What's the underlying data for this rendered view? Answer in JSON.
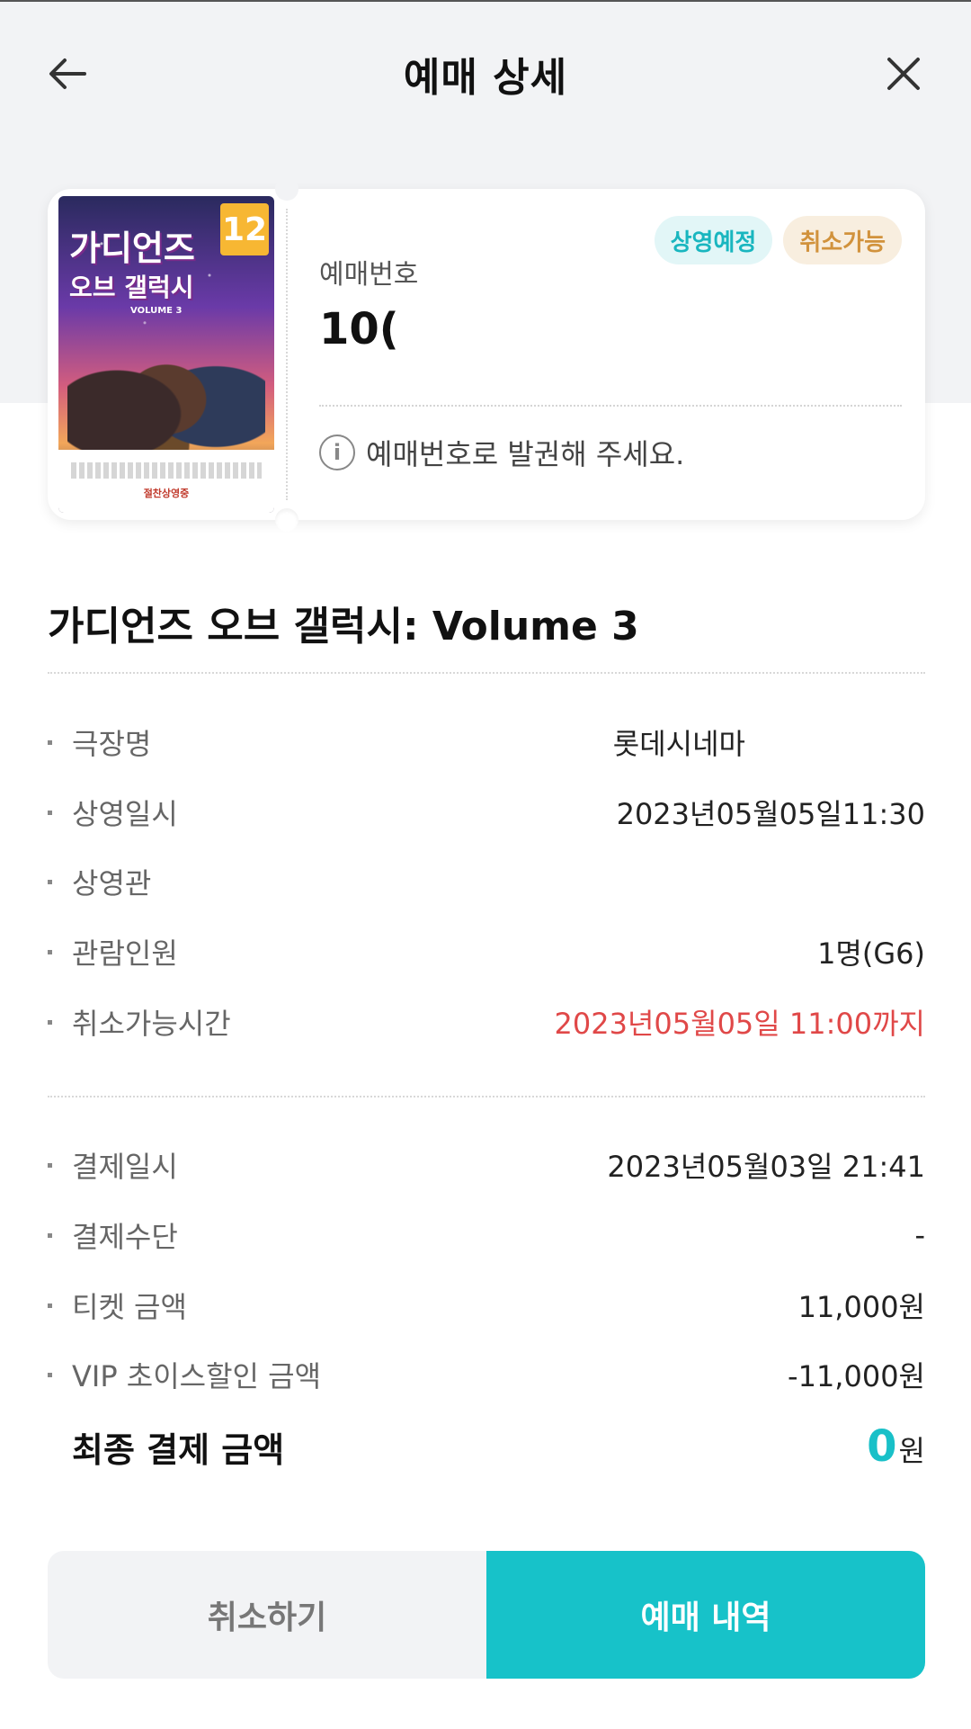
{
  "header": {
    "title": "예매 상세",
    "back_icon": "arrow-left-icon",
    "close_icon": "close-icon"
  },
  "ticket": {
    "poster": {
      "title_line1": "가디언즈",
      "title_line2": "오브 갤럭시",
      "rating": "12",
      "subtitle": "VOLUME 3",
      "release_text": "절찬상영중"
    },
    "badges": [
      "상영예정",
      "취소가능"
    ],
    "booking_label": "예매번호",
    "booking_number": "10(",
    "notice": "예매번호로 발권해 주세요.",
    "info_icon": "info-icon"
  },
  "movie_title": "가디언즈 오브 갤럭시: Volume 3",
  "details": [
    {
      "label": "극장명",
      "value": "롯데시네마"
    },
    {
      "label": "상영일시",
      "value": "2023년05월05일11:30"
    },
    {
      "label": "상영관",
      "value": ""
    },
    {
      "label": "관람인원",
      "value": "1명(G6)"
    },
    {
      "label": "취소가능시간",
      "value": "2023년05월05일 11:00까지"
    }
  ],
  "payment": [
    {
      "label": "결제일시",
      "value": "2023년05월03일 21:41"
    },
    {
      "label": "결제수단",
      "value": "-"
    },
    {
      "label": "티켓 금액",
      "value": "11,000원"
    },
    {
      "label": "VIP 초이스할인 금액",
      "value": "-11,000원"
    }
  ],
  "final": {
    "label": "최종 결제 금액",
    "amount": "0",
    "unit": "원"
  },
  "buttons": {
    "cancel": "취소하기",
    "history": "예매 내역"
  },
  "colors": {
    "accent": "#17c2c9",
    "warning": "#e04848",
    "badge_teal": "#19b6bf",
    "badge_tan": "#d1923c"
  }
}
